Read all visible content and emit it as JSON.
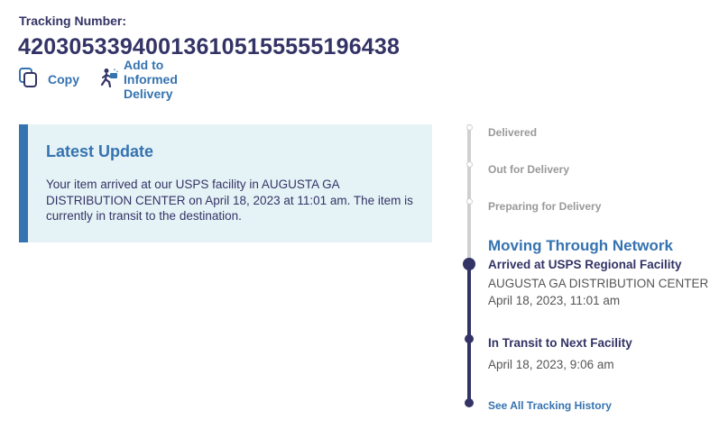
{
  "tracking": {
    "label": "Tracking Number:",
    "number": "420305339400136105155555196438"
  },
  "actions": {
    "copy_label": "Copy",
    "informed_delivery_label": "Add to Informed Delivery"
  },
  "latest_update": {
    "title": "Latest Update",
    "body": "Your item arrived at our USPS facility in AUGUSTA GA DISTRIBUTION CENTER on April 18, 2023 at 11:01 am. The item is currently in transit to the destination."
  },
  "timeline": {
    "future_steps": [
      "Delivered",
      "Out for Delivery",
      "Preparing for Delivery"
    ],
    "current_status": "Moving Through Network",
    "events": [
      {
        "title": "Arrived at USPS Regional Facility",
        "location": "AUGUSTA GA DISTRIBUTION CENTER",
        "datetime": "April 18, 2023, 11:01 am"
      },
      {
        "title": "In Transit to Next Facility",
        "datetime": "April 18, 2023, 9:06 am"
      }
    ],
    "history_link": "See All Tracking History"
  },
  "colors": {
    "navy": "#333366",
    "accent_blue": "#3573b1",
    "card_background": "#e6f3f6",
    "future_grey": "#999999"
  },
  "icons": {
    "copy": "copy-icon",
    "informed_delivery": "mail-carrier-icon"
  }
}
